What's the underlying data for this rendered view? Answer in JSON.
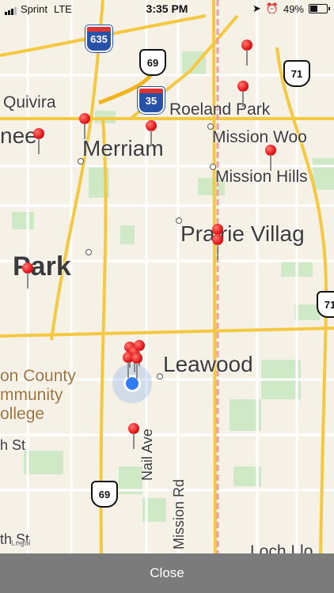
{
  "status_bar": {
    "carrier": "Sprint",
    "network": "LTE",
    "time": "3:35 PM",
    "battery": "49%"
  },
  "map": {
    "places": {
      "quivira": "Quivira",
      "nee": "nee",
      "merriam": "Merriam",
      "roeland_park": "Roeland Park",
      "mission_woods": "Mission Woo",
      "mission_hills": "Mission Hills",
      "prairie_village": "Prairie Villag",
      "park": "Park",
      "leawood": "Leawood",
      "college_1": "on County",
      "college_2": "mmunity",
      "college_3": "ollege",
      "th_st_1": "h St",
      "th_st_2": "th St",
      "loch": "Loch Llo"
    },
    "roads": {
      "nail_ave": "Nail Ave",
      "mission_rd": "Mission Rd"
    },
    "shields": {
      "i635": "635",
      "us69_top": "69",
      "i35": "35",
      "us71_top": "71",
      "us71_right": "71",
      "us69_bottom": "69"
    },
    "legal": "Legal"
  },
  "close_label": "Close"
}
